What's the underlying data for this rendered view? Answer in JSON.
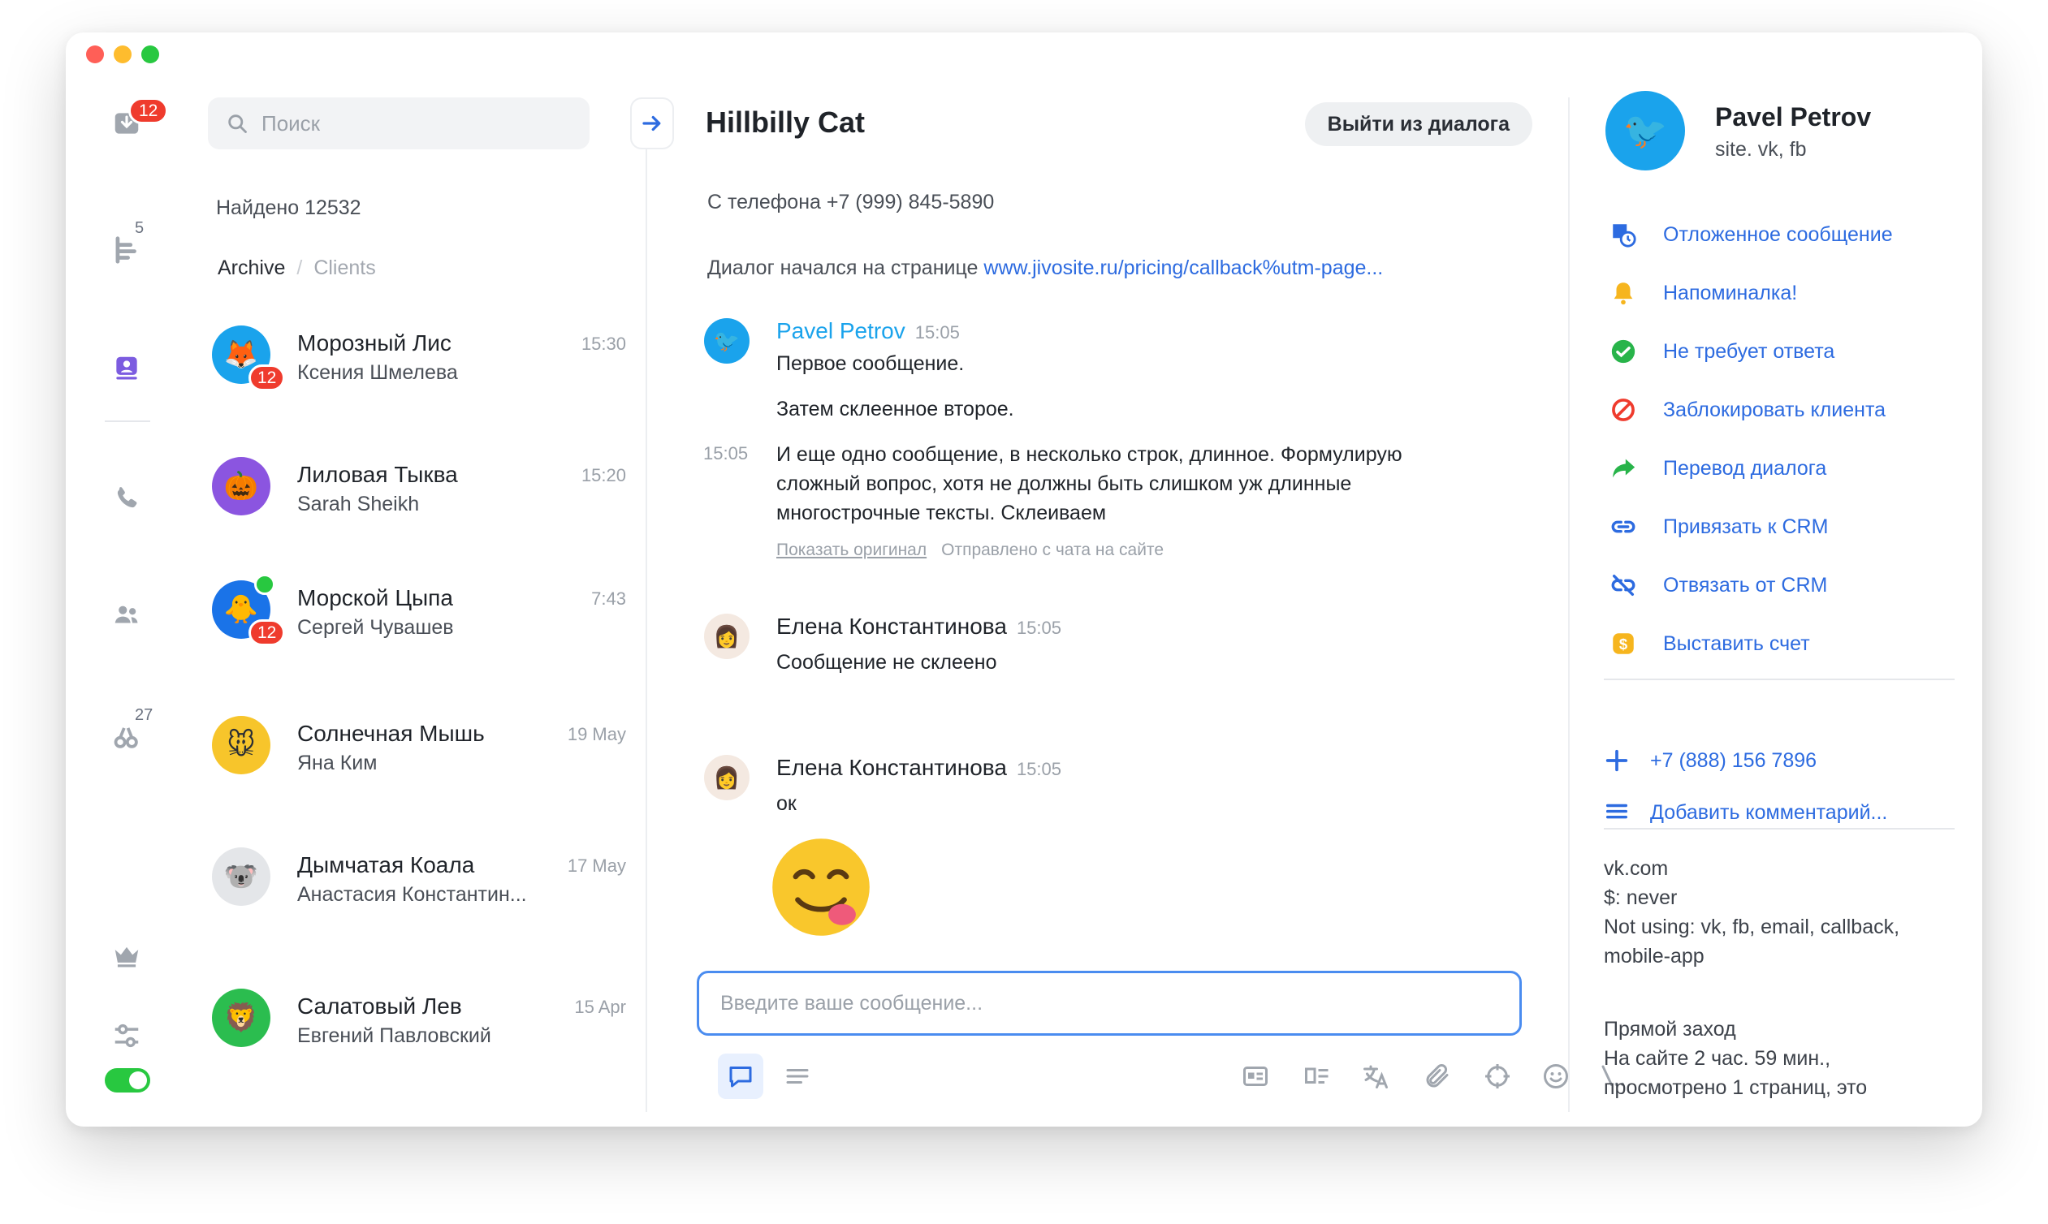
{
  "window": {
    "traffic_lights": [
      "close",
      "minimize",
      "maximize"
    ]
  },
  "rail": {
    "inbox_badge": "12",
    "queue_count": "5",
    "visitors_count": "27"
  },
  "list": {
    "search_placeholder": "Поиск",
    "found": "Найдено 12532",
    "tab_archive": "Archive",
    "tab_separator": "/",
    "tab_clients": "Clients",
    "items": [
      {
        "name": "Морозный Лис",
        "sub": "Ксения Шмелева",
        "time": "15:30",
        "badge": "12",
        "emoji": "🦊",
        "color": "#1aa3ec"
      },
      {
        "name": "Лиловая Тыква",
        "sub": "Sarah Sheikh",
        "time": "15:20",
        "badge": "",
        "emoji": "🎃",
        "color": "#8b55e0"
      },
      {
        "name": "Морской Цыпа",
        "sub": "Сергей Чувашев",
        "time": "7:43",
        "badge": "12",
        "emoji": "🐥",
        "color": "#1a73e8"
      },
      {
        "name": "Солнечная Мышь",
        "sub": "Яна Ким",
        "time": "19 May",
        "badge": "",
        "emoji": "🐭",
        "color": "#f7c52b"
      },
      {
        "name": "Дымчатая Коала",
        "sub": "Анастасия Константин...",
        "time": "17 May",
        "badge": "",
        "emoji": "🐨",
        "color": "#e4e6e9"
      },
      {
        "name": "Салатовый Лев",
        "sub": "Евгений Павловский",
        "time": "15 Apr",
        "badge": "",
        "emoji": "🦁",
        "color": "#2bbd4f"
      }
    ]
  },
  "chat": {
    "title": "Hillbilly Cat",
    "leave_button": "Выйти из диалога",
    "phone_line": "С телефона +7 (999) 845-5890",
    "page_prefix": "Диалог начался на странице",
    "page_link": "www.jivosite.ru/pricing/callback%utm-page...",
    "msg1": {
      "author": "Pavel Petrov",
      "time": "15:05",
      "line1": "Первое сообщение.",
      "line2": "Затем склеенное второе.",
      "side_time": "15:05",
      "line3": "И еще одно сообщение, в несколько строк, длинное. Формулирую сложный вопрос, хотя не должны быть слишком уж длинные многострочные тексты. Склеиваем",
      "show_original": "Показать оригинал",
      "sent_from": "Отправлено с чата на сайте"
    },
    "msg2": {
      "author": "Елена Константинова",
      "time": "15:05",
      "text": "Сообщение не склеено"
    },
    "msg3": {
      "author": "Елена Константинова",
      "time": "15:05",
      "text": "ок"
    },
    "composer_placeholder": "Введите ваше сообщение...",
    "toolbar_icons": [
      "chat-bubble-icon",
      "text-lines-icon",
      "contact-card-icon",
      "template-icon",
      "translate-icon",
      "paperclip-icon",
      "crosshair-icon",
      "smiley-icon",
      "shortcut-icon"
    ]
  },
  "info": {
    "name": "Pavel Petrov",
    "sources": "site. vk, fb",
    "actions": [
      {
        "label": "Отложенное сообщение",
        "icon": "scheduled-message-icon"
      },
      {
        "label": "Напоминалка!",
        "icon": "bell-icon"
      },
      {
        "label": "Не требует ответа",
        "icon": "check-circle-icon"
      },
      {
        "label": "Заблокировать клиента",
        "icon": "block-icon"
      },
      {
        "label": "Перевод диалога",
        "icon": "forward-arrow-icon"
      },
      {
        "label": "Привязать к CRM",
        "icon": "link-icon"
      },
      {
        "label": "Отвязать от CRM",
        "icon": "unlink-icon"
      },
      {
        "label": "Выставить счет",
        "icon": "dollar-icon"
      }
    ],
    "phone": "+7 (888) 156 7896",
    "add_comment": "Добавить комментарий...",
    "details": [
      "vk.com",
      "$: never",
      "Not using: vk, fb, email, callback,",
      "mobile-app"
    ],
    "visit": [
      "Прямой заход",
      "На сайте 2 час. 59 мин.,",
      "просмотрено 1 страниц, это"
    ]
  },
  "colors": {
    "accent": "#2d6be0",
    "badge": "#ef3b2d",
    "online": "#28c840",
    "author_blue": "#1aa3ec"
  }
}
